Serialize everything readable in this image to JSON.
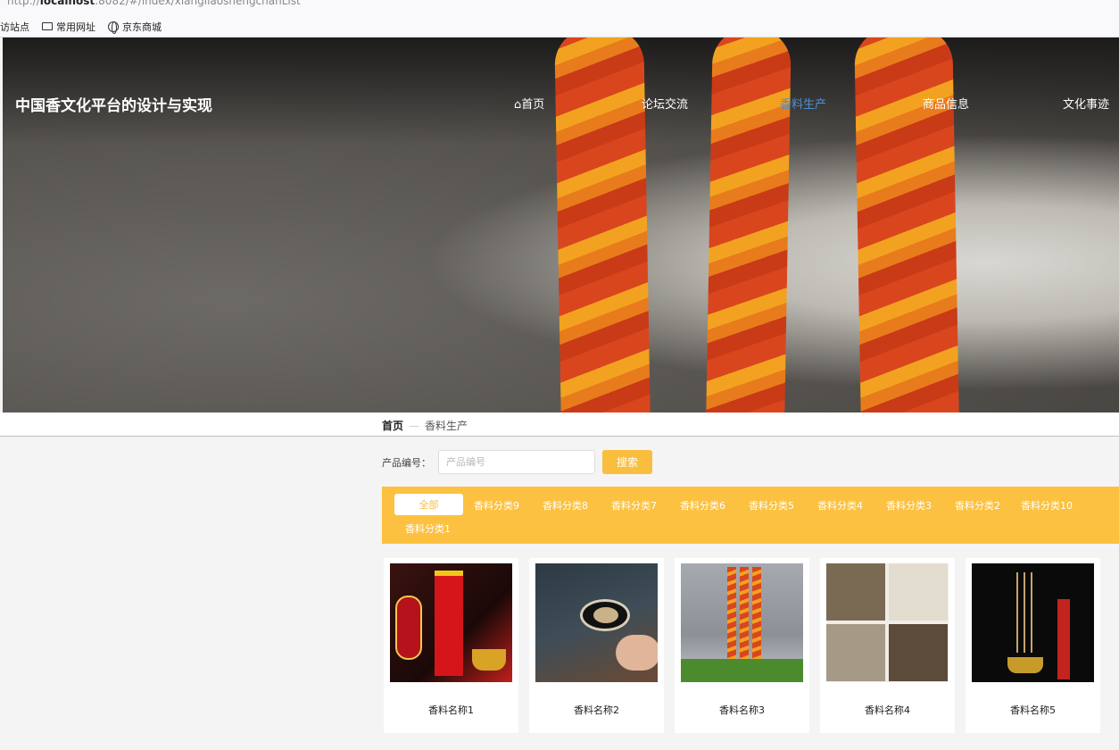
{
  "browser": {
    "url_prefix": "http://",
    "url_host": "localhost",
    "url_rest": ":8082/#/index/xiangliaoshengchanList"
  },
  "bookmarks": {
    "items": [
      {
        "label": "访站点",
        "icon": "none"
      },
      {
        "label": "常用网址",
        "icon": "folder-icon"
      },
      {
        "label": "京东商城",
        "icon": "globe-icon"
      }
    ]
  },
  "header": {
    "site_title": "中国香文化平台的设计与实现",
    "nav": [
      {
        "label": "⌂首页"
      },
      {
        "label": "论坛交流"
      },
      {
        "label": "香料生产"
      },
      {
        "label": "商品信息"
      },
      {
        "label": "文化事迹"
      }
    ],
    "active_nav": "香料生产",
    "active_color": "#4a90d9"
  },
  "breadcrumb": {
    "home": "首页",
    "separator": "—",
    "current": "香料生产"
  },
  "search": {
    "label": "产品编号：",
    "placeholder": "产品编号",
    "value": "",
    "button_label": "搜索"
  },
  "categories": {
    "selected": "全部",
    "items": [
      "全部",
      "香料分类9",
      "香料分类8",
      "香料分类7",
      "香料分类6",
      "香料分类5",
      "香料分类4",
      "香料分类3",
      "香料分类2",
      "香料分类10",
      "香料分类1"
    ]
  },
  "products": [
    {
      "name": "香料名称1"
    },
    {
      "name": "香料名称2"
    },
    {
      "name": "香料名称3"
    },
    {
      "name": "香料名称4"
    },
    {
      "name": "香料名称5"
    }
  ],
  "colors": {
    "accent": "#fcc140",
    "search_button": "#f9be3d",
    "nav_active": "#4a90d9"
  }
}
